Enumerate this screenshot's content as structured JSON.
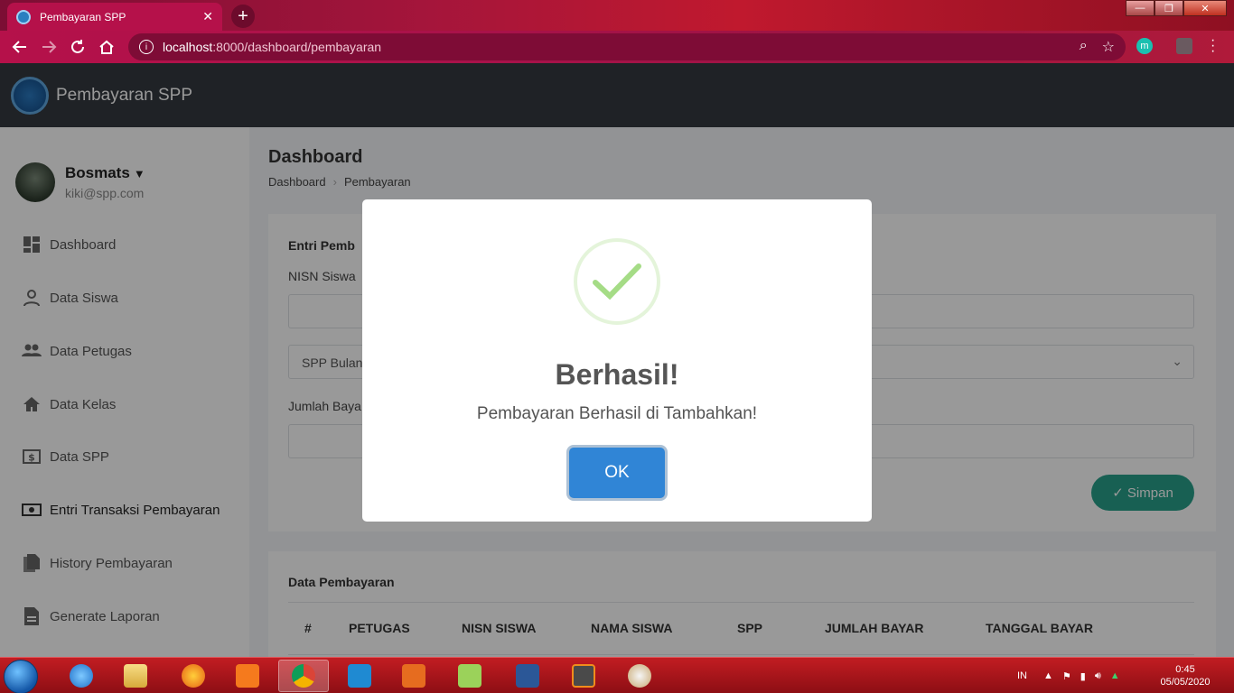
{
  "browser": {
    "tab_title": "Pembayaran SPP",
    "url_host": "localhost",
    "url_path": ":8000/dashboard/pembayaran",
    "extension_label": "m"
  },
  "app": {
    "brand": "Pembayaran SPP"
  },
  "user": {
    "name": "Bosmats",
    "email": "kiki@spp.com"
  },
  "sidebar": {
    "items": [
      {
        "label": "Dashboard",
        "icon": "dashboard-icon"
      },
      {
        "label": "Data Siswa",
        "icon": "person-icon"
      },
      {
        "label": "Data Petugas",
        "icon": "people-icon"
      },
      {
        "label": "Data Kelas",
        "icon": "home-icon"
      },
      {
        "label": "Data SPP",
        "icon": "dollar-icon"
      },
      {
        "label": "Entri Transaksi Pembayaran",
        "icon": "money-icon"
      },
      {
        "label": "History Pembayaran",
        "icon": "documents-icon"
      },
      {
        "label": "Generate Laporan",
        "icon": "report-icon"
      }
    ]
  },
  "page": {
    "title": "Dashboard",
    "breadcrumb": [
      "Dashboard",
      "Pembayaran"
    ]
  },
  "form": {
    "title": "Entri Pemb",
    "nisn_label": "NISN Siswa",
    "spp_select": "SPP Bulan",
    "jumlah_label": "Jumlah Baya",
    "submit_label": "✓ Simpan"
  },
  "table": {
    "title": "Data Pembayaran",
    "columns": [
      "#",
      "PETUGAS",
      "NISN SISWA",
      "NAMA SISWA",
      "SPP",
      "JUMLAH BAYAR",
      "TANGGAL BAYAR"
    ]
  },
  "modal": {
    "title": "Berhasil!",
    "text": "Pembayaran Berhasil di Tambahkan!",
    "ok_label": "OK"
  },
  "taskbar": {
    "language": "IN",
    "time": "0:45",
    "date": "05/05/2020"
  },
  "colors": {
    "accent": "#3085d6",
    "success": "#a5dc86",
    "header_bg": "#343a40",
    "simpan_bg": "#28a08a"
  }
}
